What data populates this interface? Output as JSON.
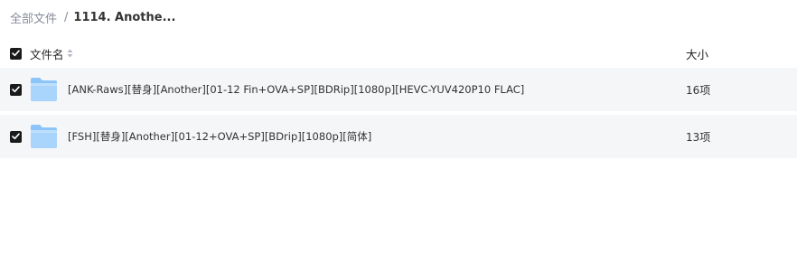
{
  "breadcrumb": {
    "root": "全部文件",
    "separator": "/",
    "current": "1114. Anothe..."
  },
  "table": {
    "header": {
      "name": "文件名",
      "size": "大小",
      "select_all_checked": true
    },
    "rows": [
      {
        "checked": true,
        "icon": "folder-icon",
        "name": "[ANK-Raws][替身][Another][01-12 Fin+OVA+SP][BDRip][1080p][HEVC-YUV420P10 FLAC]",
        "size": "16项"
      },
      {
        "checked": true,
        "icon": "folder-icon",
        "name": "[FSH][替身][Another][01-12+OVA+SP][BDrip][1080p][简体]",
        "size": "13项"
      }
    ]
  },
  "colors": {
    "row_background": "#f5f6f8",
    "checkbox": "#1a1a1a",
    "folder_light": "#a9d4fb",
    "folder_dark": "#6fb6f6",
    "breadcrumb_muted": "#878c9c"
  }
}
